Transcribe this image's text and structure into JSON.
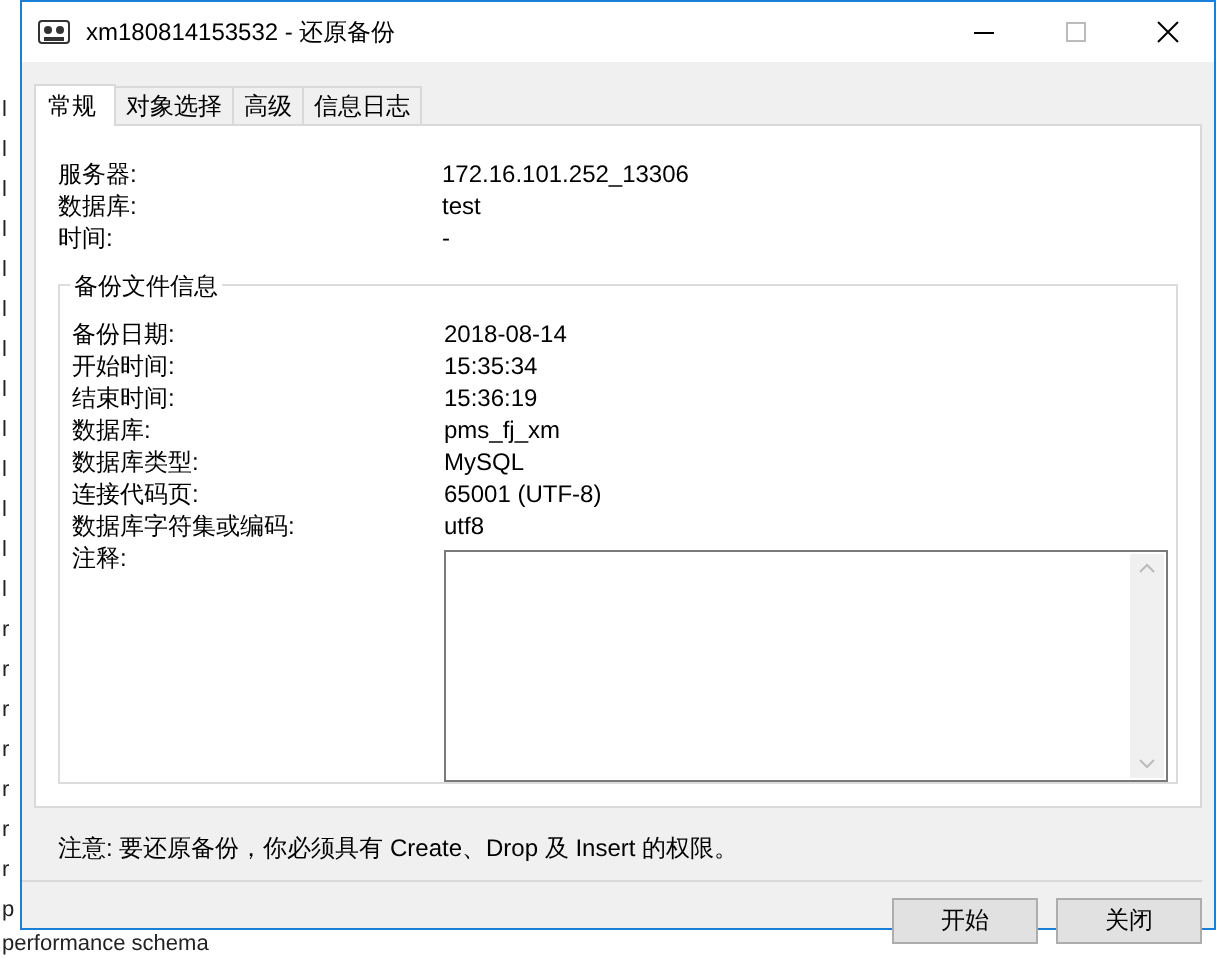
{
  "background": {
    "items": [
      "l",
      "l",
      "l",
      "l",
      "l",
      "l",
      "l",
      "l",
      "l",
      "l",
      "l",
      "l",
      "l",
      "r",
      "r",
      "r",
      "r",
      "r",
      "r",
      "r",
      "p",
      "performance schema"
    ]
  },
  "window": {
    "title": "xm180814153532 - 还原备份"
  },
  "tabs": [
    {
      "label": "常规",
      "selected": true
    },
    {
      "label": "对象选择",
      "selected": false
    },
    {
      "label": "高级",
      "selected": false
    },
    {
      "label": "信息日志",
      "selected": false
    }
  ],
  "general": [
    {
      "label": "服务器:",
      "value": "172.16.101.252_13306"
    },
    {
      "label": "数据库:",
      "value": "test"
    },
    {
      "label": "时间:",
      "value": "-"
    }
  ],
  "backup_info": {
    "title": "备份文件信息",
    "rows": [
      {
        "label": "备份日期:",
        "value": "2018-08-14"
      },
      {
        "label": "开始时间:",
        "value": "15:35:34"
      },
      {
        "label": "结束时间:",
        "value": "15:36:19"
      },
      {
        "label": "数据库:",
        "value": "pms_fj_xm"
      },
      {
        "label": "数据库类型:",
        "value": "MySQL"
      },
      {
        "label": "连接代码页:",
        "value": "65001 (UTF-8)"
      },
      {
        "label": "数据库字符集或编码:",
        "value": "utf8"
      }
    ],
    "comment_label": "注释:"
  },
  "note": "注意: 要还原备份，你必须具有 Create、Drop 及 Insert 的权限。",
  "buttons": [
    "开始",
    "关闭"
  ]
}
